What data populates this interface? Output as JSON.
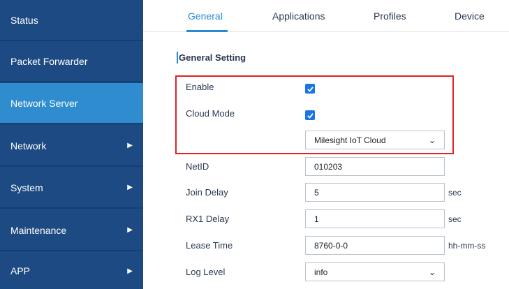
{
  "sidebar": {
    "items": [
      {
        "label": "Status",
        "has_arrow": false
      },
      {
        "label": "Packet Forwarder",
        "has_arrow": false
      },
      {
        "label": "Network Server",
        "has_arrow": false,
        "active": true
      },
      {
        "label": "Network",
        "has_arrow": true
      },
      {
        "label": "System",
        "has_arrow": true
      },
      {
        "label": "Maintenance",
        "has_arrow": true
      },
      {
        "label": "APP",
        "has_arrow": true
      }
    ],
    "arrow_glyph": "▶"
  },
  "tabs": [
    {
      "label": "General",
      "active": true
    },
    {
      "label": "Applications"
    },
    {
      "label": "Profiles"
    },
    {
      "label": "Device"
    }
  ],
  "section": {
    "title": "General Setting"
  },
  "form": {
    "enable_label": "Enable",
    "enable_checked": true,
    "cloud_mode_label": "Cloud Mode",
    "cloud_mode_checked": true,
    "cloud_select_value": "Milesight IoT Cloud",
    "netid_label": "NetID",
    "netid_value": "010203",
    "join_delay_label": "Join Delay",
    "join_delay_value": "5",
    "join_delay_unit": "sec",
    "rx1_delay_label": "RX1 Delay",
    "rx1_delay_value": "1",
    "rx1_delay_unit": "sec",
    "lease_time_label": "Lease Time",
    "lease_time_value": "8760-0-0",
    "lease_time_unit": "hh-mm-ss",
    "log_level_label": "Log Level",
    "log_level_value": "info"
  },
  "colors": {
    "sidebar_bg": "#1d4a82",
    "sidebar_active": "#2e8ccf",
    "accent": "#2a8bd4",
    "highlight_border": "#e42124",
    "checkbox": "#1a73e8"
  }
}
